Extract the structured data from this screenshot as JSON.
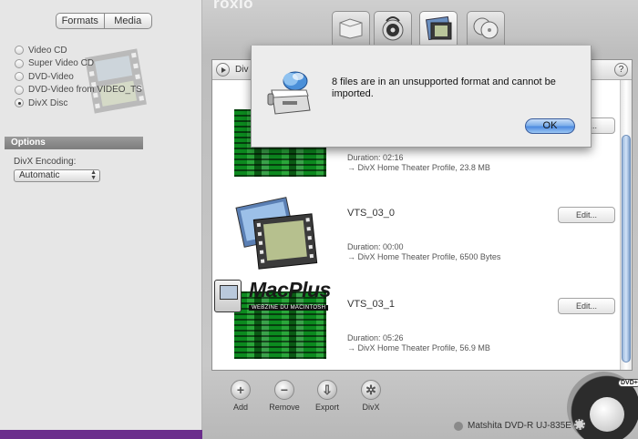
{
  "app": {
    "logo": "roxio"
  },
  "left_panel": {
    "segmented": {
      "formats_label": "Formats",
      "media_label": "Media",
      "selected": "Formats"
    },
    "formats": [
      {
        "label": "Video CD",
        "selected": false
      },
      {
        "label": "Super Video CD",
        "selected": false
      },
      {
        "label": "DVD-Video",
        "selected": false
      },
      {
        "label": "DVD-Video from VIDEO_TS",
        "selected": false
      },
      {
        "label": "DivX Disc",
        "selected": true
      }
    ],
    "options": {
      "header": "Options",
      "encoding_label": "DivX Encoding:",
      "encoding_value": "Automatic"
    }
  },
  "project_tabs": [
    {
      "icon": "data-disc-icon",
      "active": false
    },
    {
      "icon": "audio-disc-icon",
      "active": false
    },
    {
      "icon": "video-disc-icon",
      "active": true
    },
    {
      "icon": "copy-disc-icon",
      "active": false
    }
  ],
  "content": {
    "disc_name": "Div",
    "help_label": "?",
    "rows": [
      {
        "title": "",
        "duration": "Duration: 02:16",
        "profile": "→ DivX Home Theater Profile, 23.8 MB",
        "edit_label": "Edit..."
      },
      {
        "title": "VTS_03_0",
        "duration": "Duration: 00:00",
        "profile": "→ DivX Home Theater Profile, 6500 Bytes",
        "edit_label": "Edit..."
      },
      {
        "title": "VTS_03_1",
        "duration": "Duration: 05:26",
        "profile": "→ DivX Home Theater Profile, 56.9 MB",
        "edit_label": "Edit..."
      }
    ]
  },
  "toolbar": {
    "add_label": "Add",
    "remove_label": "Remove",
    "export_label": "Export",
    "divx_label": "DivX"
  },
  "drive": {
    "name": "Matshita DVD-R  UJ-835E",
    "badge": "DVD+"
  },
  "watermark": {
    "word": "MacPlus",
    "tagline": "WEBZINE DU MACINTOSH"
  },
  "alert": {
    "message": "8 files are in an unsupported format and cannot be imported.",
    "ok_label": "OK"
  },
  "colors": {
    "accent": "#4e8be0",
    "video_green": "#0a7a1a",
    "drawer_bottom": "#6b2d8c"
  }
}
